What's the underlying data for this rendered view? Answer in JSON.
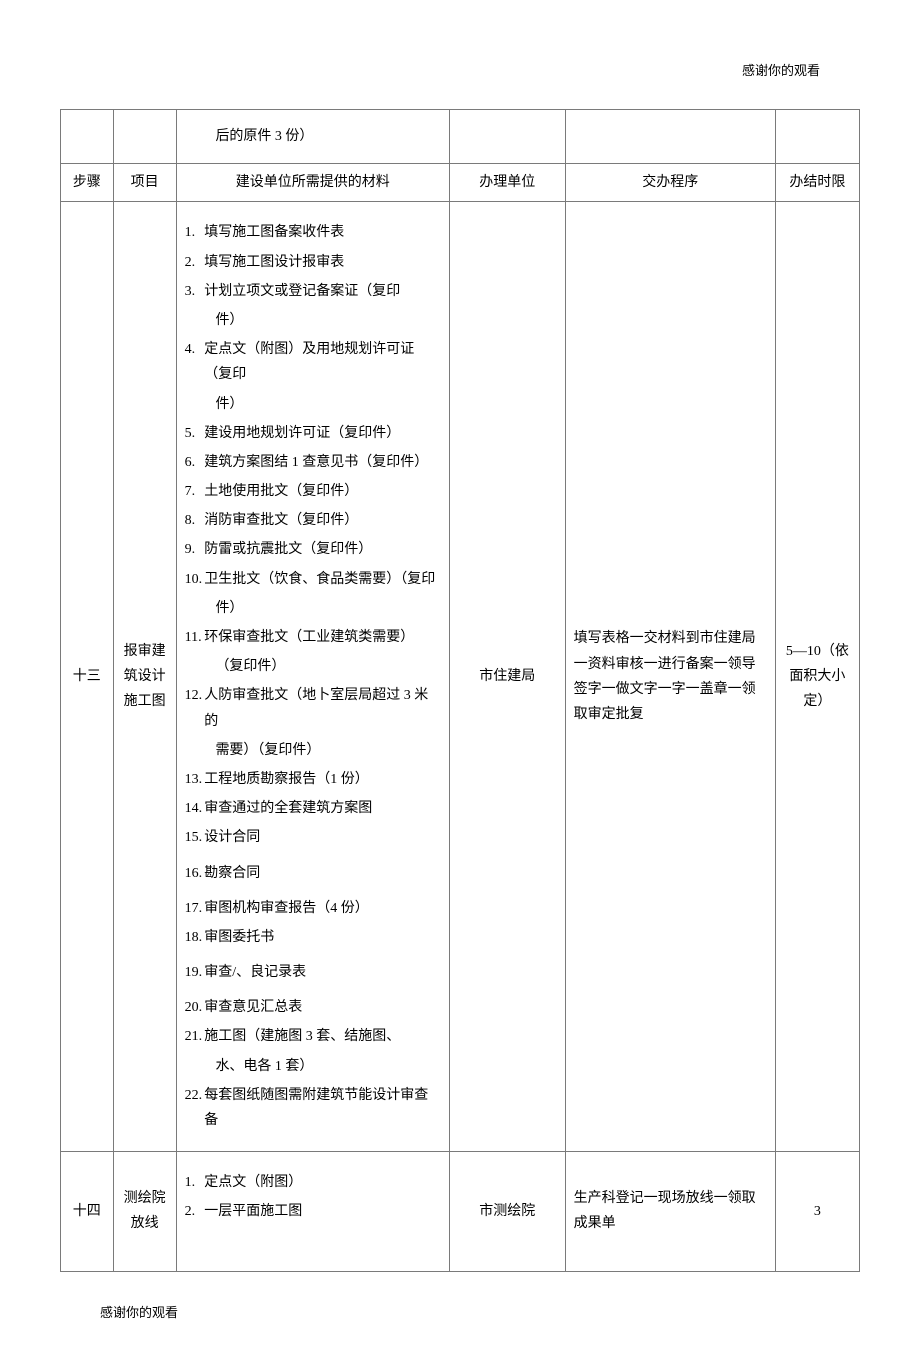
{
  "notes": {
    "header": "感谢你的观看",
    "footer": "感谢你的观看"
  },
  "headers": {
    "step": "步骤",
    "project": "项目",
    "materials": "建设单位所需提供的材料",
    "agency": "办理单位",
    "procedure": "交办程序",
    "deadline": "办结时限"
  },
  "rows": [
    {
      "step": "",
      "project": "",
      "materials_text": "后的原件 3 份）",
      "agency": "",
      "procedure": "",
      "deadline": ""
    },
    {
      "step": "十三",
      "project": "报审建筑设计施工图",
      "materials": [
        {
          "n": "1.",
          "t": "填写施工图备案收件表"
        },
        {
          "n": "2.",
          "t": "填写施工图设计报审表"
        },
        {
          "n": "3.",
          "t": "计划立项文或登记备案证（复印"
        },
        {
          "n": "",
          "t": "件）",
          "sub": true
        },
        {
          "n": "4.",
          "t": "定点文（附图）及用地规划许可证（复印"
        },
        {
          "n": "",
          "t": "件）",
          "sub": true
        },
        {
          "n": "5.",
          "t": "建设用地规划许可证（复印件）"
        },
        {
          "n": "6.",
          "t": "建筑方案图结 1 查意见书（复印件）"
        },
        {
          "n": "7.",
          "t": "土地使用批文（复印件）"
        },
        {
          "n": "8.",
          "t": "消防审查批文（复印件）"
        },
        {
          "n": "9.",
          "t": "防雷或抗震批文（复印件）"
        },
        {
          "n": "10.",
          "t": "卫生批文（饮食、食品类需要）（复印"
        },
        {
          "n": "",
          "t": "件）",
          "sub": true
        },
        {
          "n": "11.",
          "t": "环保审查批文（工业建筑类需要）"
        },
        {
          "n": "",
          "t": "（复印件）",
          "sub": true
        },
        {
          "n": "12.",
          "t": "人防审查批文（地卜室层局超过 3 米的"
        },
        {
          "n": "",
          "t": "需要）（复印件）",
          "sub": true
        },
        {
          "n": "13.",
          "t": " 工程地质勘察报告（1 份）"
        },
        {
          "n": "14.",
          "t": " 审查通过的全套建筑方案图"
        },
        {
          "n": "15.",
          "t": "设计合同"
        },
        {
          "n": "16.",
          "t": "勘察合同"
        },
        {
          "n": "17.",
          "t": "审图机构审查报告（4 份）"
        },
        {
          "n": "18.",
          "t": "审图委托书"
        },
        {
          "n": "19.",
          "t": "审查/、良记录表"
        },
        {
          "n": "20.",
          "t": " 审查意见汇总表"
        },
        {
          "n": "21.",
          "t": "施工图（建施图 3 套、结施图、"
        },
        {
          "n": "",
          "t": "水、电各 1 套）",
          "sub": true
        },
        {
          "n": "22.",
          "t": "每套图纸随图需附建筑节能设计审查备"
        }
      ],
      "agency": "市住建局",
      "procedure": "填写表格一交材料到市住建局一资料审核一进行备案一领导签字一做文字一字一盖章一领取审定批复",
      "deadline": "5—10（依面积大小定）"
    },
    {
      "step": "十四",
      "project": "测绘院放线",
      "materials": [
        {
          "n": "1.",
          "t": "定点文（附图）"
        },
        {
          "n": "2.",
          "t": "一层平面施工图"
        }
      ],
      "agency": "市测绘院",
      "procedure": "生产科登记一现场放线一领取成果单",
      "deadline": "3"
    }
  ]
}
